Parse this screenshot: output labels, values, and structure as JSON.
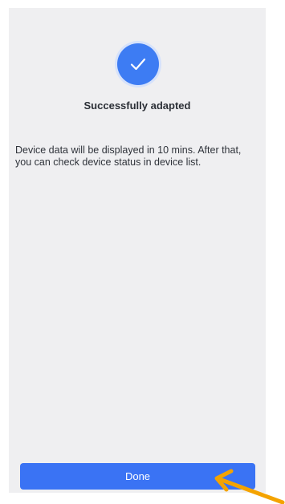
{
  "result": {
    "icon": "checkmark-icon",
    "title": "Successfully adapted",
    "message": "Device data will be displayed in 10 mins. After that, you can check device status in device list."
  },
  "actions": {
    "done_label": "Done"
  },
  "annotation": {
    "icon": "arrow-pointer-icon",
    "color": "#f4a300"
  },
  "colors": {
    "accent": "#3a73f4",
    "background": "#efeff1"
  }
}
